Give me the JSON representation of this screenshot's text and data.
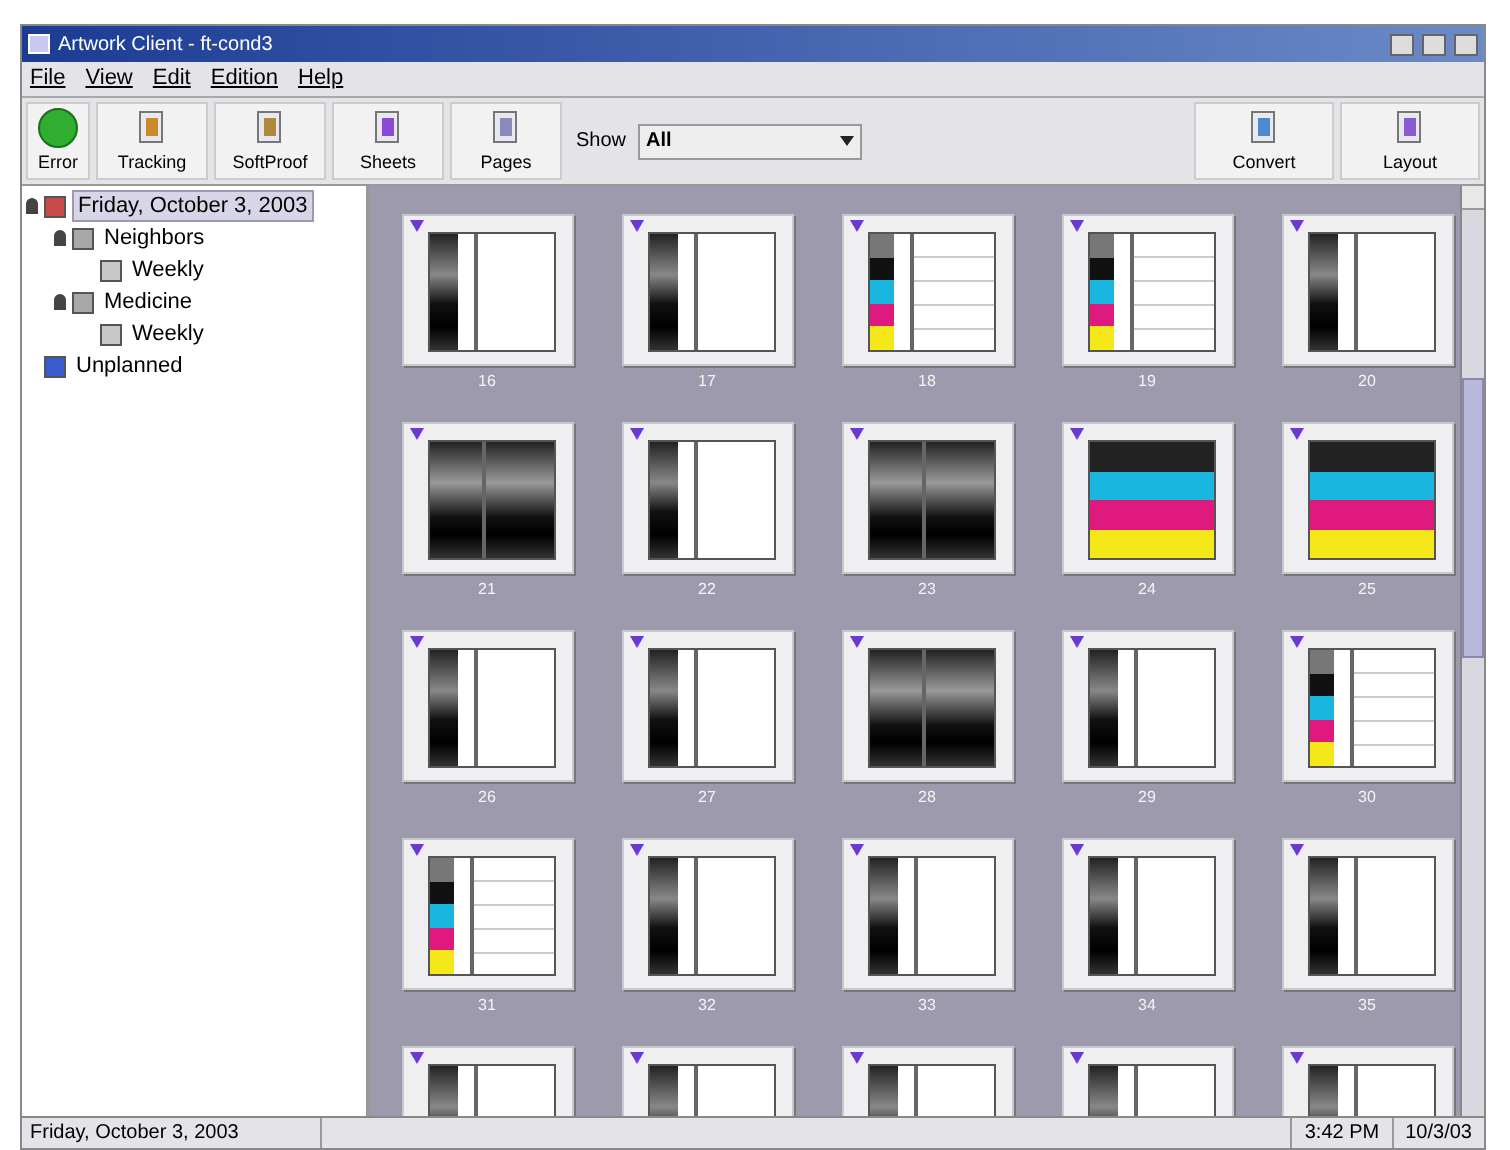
{
  "window": {
    "title": "Artwork Client - ft-cond3"
  },
  "menu": [
    "File",
    "View",
    "Edit",
    "Edition",
    "Help"
  ],
  "toolbar": [
    {
      "label": "Error",
      "kind": "status"
    },
    {
      "label": "Tracking",
      "kind": "tracking"
    },
    {
      "label": "SoftProof",
      "kind": "softproof"
    },
    {
      "label": "Sheets",
      "kind": "sheets"
    },
    {
      "label": "Pages",
      "kind": "pages"
    }
  ],
  "show": {
    "label": "Show",
    "value": "All"
  },
  "toolbar_right": [
    {
      "label": "Convert",
      "kind": "convert"
    },
    {
      "label": "Layout",
      "kind": "layout"
    }
  ],
  "tree": [
    {
      "label": "Friday, October 3, 2003",
      "kind": "date",
      "selected": true,
      "expanded": true,
      "children": [
        {
          "label": "Neighbors",
          "kind": "folder",
          "selected": false,
          "expanded": true,
          "children": [
            {
              "label": "Weekly",
              "kind": "issue",
              "selected": false
            }
          ]
        },
        {
          "label": "Medicine",
          "kind": "folder",
          "selected": false,
          "expanded": true,
          "children": [
            {
              "label": "Weekly",
              "kind": "issue",
              "selected": false
            }
          ]
        }
      ]
    },
    {
      "label": "Unplanned",
      "kind": "unplanned",
      "selected": false
    }
  ],
  "pages": [
    {
      "number": "16",
      "kind": "strip"
    },
    {
      "number": "17",
      "kind": "strip"
    },
    {
      "number": "18",
      "kind": "cmyk-strip"
    },
    {
      "number": "19",
      "kind": "cmyk-strip"
    },
    {
      "number": "20",
      "kind": "strip"
    },
    {
      "number": "21",
      "kind": "gradient"
    },
    {
      "number": "22",
      "kind": "strip"
    },
    {
      "number": "23",
      "kind": "gradient"
    },
    {
      "number": "24",
      "kind": "cmyk-full"
    },
    {
      "number": "25",
      "kind": "cmyk-full"
    },
    {
      "number": "26",
      "kind": "strip"
    },
    {
      "number": "27",
      "kind": "strip"
    },
    {
      "number": "28",
      "kind": "gradient"
    },
    {
      "number": "29",
      "kind": "strip"
    },
    {
      "number": "30",
      "kind": "cmyk-strip"
    },
    {
      "number": "31",
      "kind": "cmyk-strip"
    },
    {
      "number": "32",
      "kind": "strip"
    },
    {
      "number": "33",
      "kind": "strip"
    },
    {
      "number": "34",
      "kind": "strip"
    },
    {
      "number": "35",
      "kind": "strip"
    },
    {
      "kind": "strip"
    },
    {
      "kind": "strip"
    },
    {
      "kind": "strip"
    },
    {
      "kind": "strip"
    },
    {
      "kind": "strip"
    }
  ],
  "status_bar": {
    "date": "Friday, October 3, 2003",
    "time": "3:42 PM",
    "short_date": "10/3/03"
  }
}
